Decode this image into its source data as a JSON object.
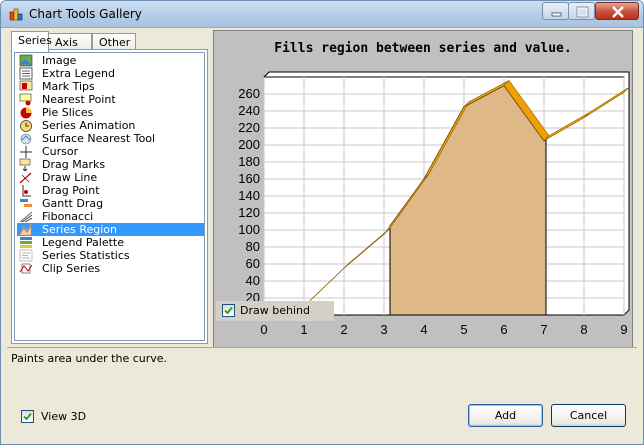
{
  "window": {
    "title": "Chart Tools Gallery"
  },
  "tabs": [
    {
      "label": "Series"
    },
    {
      "label": "Axis"
    },
    {
      "label": "Other"
    }
  ],
  "tools": [
    {
      "label": "Image",
      "icon": "image-icon"
    },
    {
      "label": "Extra Legend",
      "icon": "legend-icon"
    },
    {
      "label": "Mark Tips",
      "icon": "mark-tips-icon"
    },
    {
      "label": "Nearest Point",
      "icon": "nearest-point-icon"
    },
    {
      "label": "Pie Slices",
      "icon": "pie-slices-icon"
    },
    {
      "label": "Series Animation",
      "icon": "clock-icon"
    },
    {
      "label": "Surface Nearest Tool",
      "icon": "surface-icon"
    },
    {
      "label": "Cursor",
      "icon": "cursor-icon"
    },
    {
      "label": "Drag Marks",
      "icon": "drag-marks-icon"
    },
    {
      "label": "Draw Line",
      "icon": "draw-line-icon"
    },
    {
      "label": "Drag Point",
      "icon": "drag-point-icon"
    },
    {
      "label": "Gantt Drag",
      "icon": "gantt-icon"
    },
    {
      "label": "Fibonacci",
      "icon": "fibonacci-icon"
    },
    {
      "label": "Series Region",
      "icon": "series-region-icon"
    },
    {
      "label": "Legend Palette",
      "icon": "legend-palette-icon"
    },
    {
      "label": "Series Statistics",
      "icon": "statistics-icon"
    },
    {
      "label": "Clip Series",
      "icon": "clip-series-icon"
    }
  ],
  "selected_tool": "Series Region",
  "chart": {
    "title": "Fills region between series and value.",
    "draw_behind_label": "Draw behind",
    "draw_behind_checked": true,
    "colors": {
      "panel": "#c0c0c0",
      "line": "#f0a000",
      "region_fill": "#deb887",
      "outline": "#000000"
    }
  },
  "chart_data": {
    "type": "area",
    "title": "Fills region between series and value.",
    "x": [
      0,
      1,
      2,
      3,
      4,
      5,
      6,
      7,
      8,
      9
    ],
    "values": [
      -20,
      10,
      55,
      95,
      160,
      245,
      270,
      205,
      232,
      262
    ],
    "region": {
      "x_from": 3.15,
      "x_to": 7.05,
      "base_value": 0
    },
    "xlim": [
      0,
      9
    ],
    "ylim": [
      0,
      280
    ],
    "x_ticks": [
      "0",
      "1",
      "2",
      "3",
      "4",
      "5",
      "6",
      "7",
      "8",
      "9"
    ],
    "y_ticks": [
      "20",
      "40",
      "60",
      "80",
      "100",
      "120",
      "140",
      "160",
      "180",
      "200",
      "220",
      "240",
      "260"
    ],
    "grid": true,
    "view3d": true
  },
  "description": "Paints area under the curve.",
  "footer": {
    "view3d_label": "View 3D",
    "view3d_checked": true,
    "add_label": "Add",
    "cancel_label": "Cancel"
  }
}
